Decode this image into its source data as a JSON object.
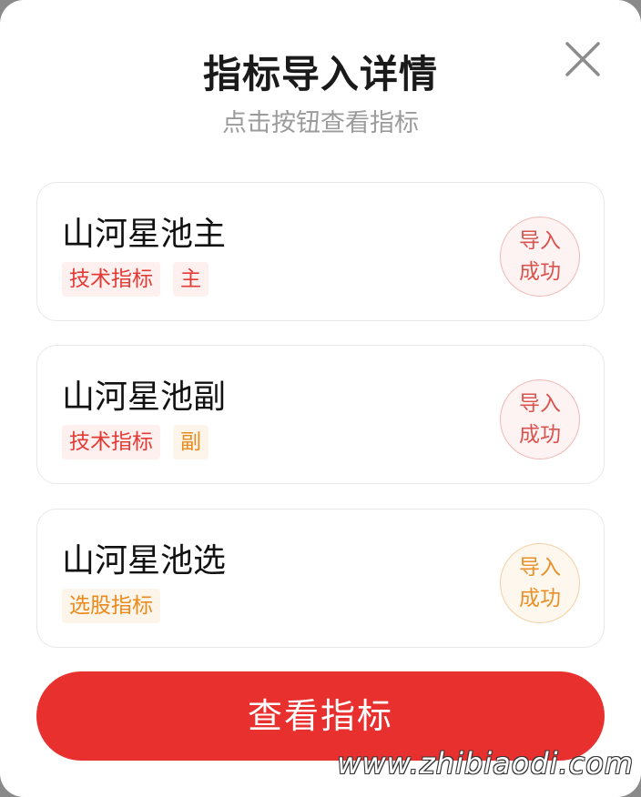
{
  "header": {
    "title": "指标导入详情",
    "subtitle": "点击按钮查看指标"
  },
  "close_icon": "close-icon",
  "cards": [
    {
      "title": "山河星池主",
      "tags": [
        "技术指标",
        "主"
      ],
      "tag_colors": [
        "#e23b36",
        "#e23b36"
      ],
      "status_line1": "导入",
      "status_line2": "成功",
      "status_color": "#d9534f"
    },
    {
      "title": "山河星池副",
      "tags": [
        "技术指标",
        "副"
      ],
      "tag_colors": [
        "#e23b36",
        "#ea8a1c"
      ],
      "status_line1": "导入",
      "status_line2": "成功",
      "status_color": "#d9534f"
    },
    {
      "title": "山河星池选",
      "tags": [
        "选股指标"
      ],
      "tag_colors": [
        "#ea8a1c"
      ],
      "status_line1": "导入",
      "status_line2": "成功",
      "status_color": "#e8902a"
    }
  ],
  "button": {
    "label": "查看指标",
    "color": "#e8302f"
  },
  "watermark": "www.zhibiaodi.com"
}
